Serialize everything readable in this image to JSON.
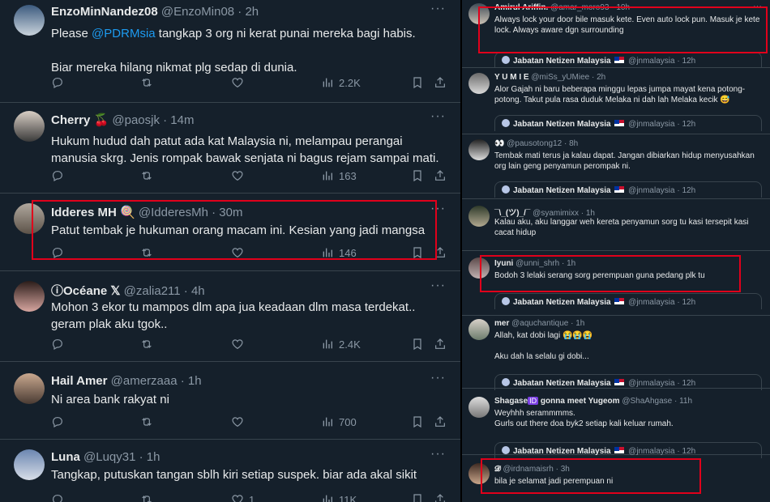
{
  "left": {
    "tweets": [
      {
        "name": "EnzoMinNandez08",
        "handle": "@EnzoMin08 · 2h",
        "body_pre": "Please ",
        "mention": "@PDRMsia",
        "body_post": " tangkap 3 org ni kerat punai mereka bagi habis.",
        "body2": "Biar mereka hilang nikmat plg sedap di dunia.",
        "views": "2.2K"
      },
      {
        "name": "Cherry 🍒",
        "handle": "@paosjk · 14m",
        "body": "Hukum hudud dah patut ada kat Malaysia ni, melampau perangai manusia skrg. Jenis rompak bawak senjata ni bagus rejam sampai mati.",
        "views": "163"
      },
      {
        "name": "Idderes MH 🍭",
        "handle": "@IdderesMh · 30m",
        "body": "Patut tembak je hukuman orang macam ini. Kesian yang jadi mangsa",
        "views": "146"
      },
      {
        "name": "ⓘOcéane 𝕏",
        "handle": "@zalia211 · 4h",
        "body": "Mohon 3 ekor tu mampos dlm apa jua keadaan dlm masa terdekat.. geram plak aku tgok..",
        "views": "2.4K"
      },
      {
        "name": "Hail Amer",
        "handle": "@amerzaaa · 1h",
        "body": "Ni area bank rakyat ni",
        "views": "700"
      },
      {
        "name": "Luna",
        "handle": "@Luqy31 · 1h",
        "body": "Tangkap, putuskan tangan sblh kiri setiap suspek. biar ada akal sikit",
        "likes": "1",
        "views": "11K"
      }
    ],
    "more": "···"
  },
  "right": {
    "quote_name": "Jabatan Netizen Malaysia",
    "quote_meta": "@jnmalaysia · 12h",
    "replies": [
      {
        "name": "Amirul Ariffin.",
        "handle": "@amar_moro93 · 10h",
        "lines": [
          "Always lock your door bile masuk kete. Even auto lock pun. Masuk je kete",
          "lock. Always aware dgn surrounding"
        ]
      },
      {
        "name": "Y U M I E",
        "handle": "@miSs_yUMiee · 2h",
        "lines": [
          "Alor Gajah ni baru beberapa minggu lepas jumpa mayat kena potong-",
          "potong. Takut pula rasa duduk Melaka ni dah lah Melaka kecik 😅"
        ]
      },
      {
        "name": "👀",
        "handle": "@pausotong12 · 8h",
        "lines": [
          "Tembak mati terus ja kalau dapat. Jangan dibiarkan hidup menyusahkan",
          "org lain geng penyamun perompak ni."
        ]
      },
      {
        "name": "¯\\_(ツ)_/¯",
        "handle": "@syamimixx · 1h",
        "lines": [
          "Kalau aku, aku langgar weh kereta penyamun sorg tu kasi tersepit kasi",
          "cacat hidup"
        ]
      },
      {
        "name": "Iyuni",
        "handle": "@unni_shrh · 1h",
        "lines": [
          "Bodoh 3 lelaki serang sorg perempuan guna pedang plk tu"
        ]
      },
      {
        "name": "mer",
        "handle": "@aquchantique · 1h",
        "lines": [
          "Allah, kat dobi lagi 😭😭😭",
          "",
          "Aku dah la selalu gi dobi..."
        ]
      },
      {
        "name": "Shagase",
        "name_suffix": "gonna meet Yugeom",
        "badge": "ID",
        "handle": "@ShaAhgase · 11h",
        "lines": [
          "Weyhhh serammmms.",
          "Gurls out there doa byk2 setiap kali keluar rumah."
        ]
      },
      {
        "name": "𝓓",
        "handle": "@irdnamaisrh · 3h",
        "lines": [
          "bila je selamat jadi perempuan ni"
        ]
      }
    ]
  },
  "colors": {
    "bg": "#15202b",
    "accent": "#1d9bf0",
    "muted": "#8b98a5",
    "highlight": "#e0001b"
  }
}
